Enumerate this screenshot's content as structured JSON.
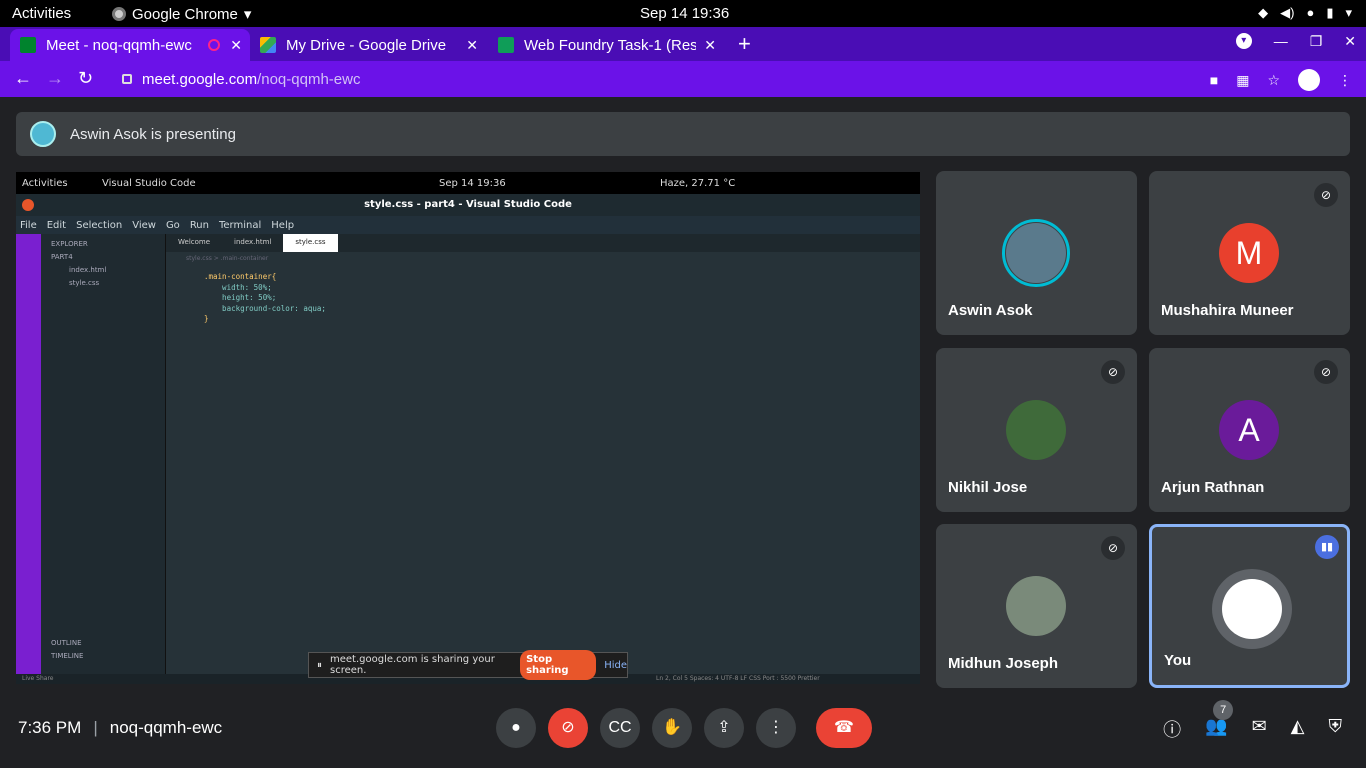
{
  "os": {
    "activities": "Activities",
    "app_name": "Google Chrome",
    "datetime": "Sep 14  19:36"
  },
  "tabs": [
    {
      "title": "Meet - noq-qqmh-ewc",
      "favicon": "meet-icon",
      "active": true
    },
    {
      "title": "My Drive - Google Drive",
      "favicon": "drive-icon"
    },
    {
      "title": "Web Foundry Task-1 (Resp",
      "favicon": "sheets-icon"
    }
  ],
  "url": {
    "host": "meet.google.com",
    "path": "/noq-qqmh-ewc"
  },
  "banner": {
    "text": "Aswin Asok is presenting"
  },
  "shared_screen": {
    "activities": "Activities",
    "app": "Visual Studio Code",
    "clock": "Sep 14  19:36",
    "weather": "Haze, 27.71 °C",
    "window_title": "style.css - part4 - Visual Studio Code",
    "menu": [
      "File",
      "Edit",
      "Selection",
      "View",
      "Go",
      "Run",
      "Terminal",
      "Help"
    ],
    "explorer": {
      "header": "EXPLORER",
      "folder": "PART4",
      "files": [
        "index.html",
        "style.css"
      ],
      "outline": "OUTLINE",
      "timeline": "TIMELINE"
    },
    "editor_tabs": [
      "Welcome",
      "index.html",
      "style.css"
    ],
    "breadcrumb": "style.css > .main-container",
    "code": [
      ".main-container{",
      "    width: 50%;",
      "    height: 50%;",
      "    background-color: aqua;",
      "}"
    ],
    "status": "Ln 2, Col 5   Spaces: 4   UTF-8   LF   CSS   Port : 5500   Prettier",
    "live_share": "Live Share",
    "share_notice": "meet.google.com is sharing your screen.",
    "stop_sharing": "Stop sharing",
    "hide": "Hide"
  },
  "participants": [
    {
      "name": "Aswin Asok",
      "muted": false
    },
    {
      "name": "Mushahira Muneer",
      "initial": "M",
      "color": "#e8402d",
      "muted": true
    },
    {
      "name": "Nikhil Jose",
      "muted": true
    },
    {
      "name": "Arjun Rathnan",
      "initial": "A",
      "color": "#6a1b9a",
      "muted": true
    },
    {
      "name": "Midhun Joseph",
      "muted": true
    },
    {
      "name": "You",
      "speaking": true
    }
  ],
  "bottom": {
    "time": "7:36 PM",
    "meeting_code": "noq-qqmh-ewc",
    "people_count": "7"
  }
}
